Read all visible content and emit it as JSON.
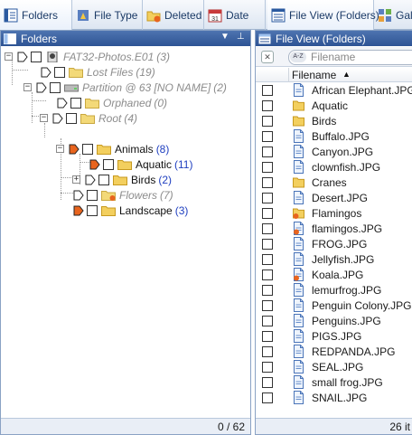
{
  "tabs": [
    {
      "label": "Folders",
      "icon": "folders-view-icon",
      "active": true
    },
    {
      "label": "File Type",
      "icon": "file-type-icon",
      "active": false
    },
    {
      "label": "Deleted",
      "icon": "deleted-folder-icon",
      "active": false
    },
    {
      "label": "Date",
      "icon": "calendar-icon",
      "active": false
    },
    {
      "label": "File View (Folders)",
      "icon": "file-view-icon",
      "active": true
    },
    {
      "label": "Gal",
      "icon": "gallery-icon",
      "active": false
    }
  ],
  "left_pane": {
    "title": "Folders",
    "status": "0 / 62",
    "tree": [
      {
        "label": "FAT32-Photos.E01",
        "count": "(3)",
        "ghost": true
      },
      {
        "label": "Lost Files",
        "count": "(19)",
        "ghost": true
      },
      {
        "label": "Partition @ 63 [NO NAME]",
        "count": "(2)",
        "ghost": true
      },
      {
        "label": "Orphaned",
        "count": "(0)",
        "ghost": true
      },
      {
        "label": "Root",
        "count": "(4)",
        "ghost": true
      },
      {
        "label": "Animals",
        "count": "(8)",
        "ghost": false
      },
      {
        "label": "Aquatic",
        "count": "(11)",
        "ghost": false
      },
      {
        "label": "Birds",
        "count": "(2)",
        "ghost": false
      },
      {
        "label": "Flowers",
        "count": "(7)",
        "ghost": true
      },
      {
        "label": "Landscape",
        "count": "(3)",
        "ghost": false
      }
    ]
  },
  "right_pane": {
    "title": "File View (Folders)",
    "filter_placeholder": "Filename",
    "sort_badge": "A-Z",
    "column_header": "Filename",
    "status": "26 it",
    "files": [
      {
        "name": "African Elephant.JPG",
        "kind": "file"
      },
      {
        "name": "Aquatic",
        "kind": "folder"
      },
      {
        "name": "Birds",
        "kind": "folder"
      },
      {
        "name": "Buffalo.JPG",
        "kind": "file"
      },
      {
        "name": "Canyon.JPG",
        "kind": "file"
      },
      {
        "name": "clownfish.JPG",
        "kind": "file"
      },
      {
        "name": "Cranes",
        "kind": "folder"
      },
      {
        "name": "Desert.JPG",
        "kind": "file"
      },
      {
        "name": "Flamingos",
        "kind": "deleted-folder"
      },
      {
        "name": "flamingos.JPG",
        "kind": "deleted-file"
      },
      {
        "name": "FROG.JPG",
        "kind": "file"
      },
      {
        "name": "Jellyfish.JPG",
        "kind": "file"
      },
      {
        "name": "Koala.JPG",
        "kind": "deleted-file"
      },
      {
        "name": "lemurfrog.JPG",
        "kind": "file"
      },
      {
        "name": "Penguin Colony.JPG",
        "kind": "file"
      },
      {
        "name": "Penguins.JPG",
        "kind": "file"
      },
      {
        "name": "PIGS.JPG",
        "kind": "file"
      },
      {
        "name": "REDPANDA.JPG",
        "kind": "file"
      },
      {
        "name": "SEAL.JPG",
        "kind": "file"
      },
      {
        "name": "small frog.JPG",
        "kind": "file"
      },
      {
        "name": "SNAIL.JPG",
        "kind": "file"
      }
    ]
  },
  "colors": {
    "header_bg": "#2d5394",
    "count_blue": "#2040c0",
    "tag_orange": "#e8641e",
    "folder_yellow": "#f3cf5e"
  }
}
